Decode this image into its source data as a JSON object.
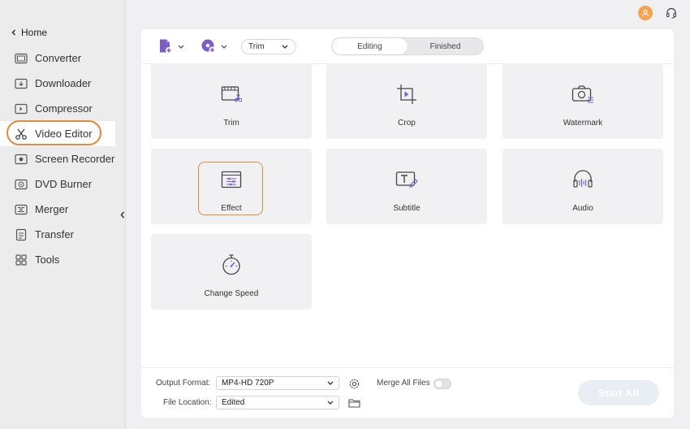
{
  "window": {
    "controls": [
      "close",
      "minimize"
    ]
  },
  "topbar": {
    "user_icon": "user-avatar-icon",
    "help_icon": "headset-icon",
    "accent": "#f6a351"
  },
  "sidebar": {
    "home_label": "Home",
    "items": [
      {
        "label": "Converter",
        "icon": "converter-icon"
      },
      {
        "label": "Downloader",
        "icon": "downloader-icon"
      },
      {
        "label": "Compressor",
        "icon": "compressor-icon"
      },
      {
        "label": "Video Editor",
        "icon": "scissors-icon",
        "active": true
      },
      {
        "label": "Screen Recorder",
        "icon": "screen-recorder-icon"
      },
      {
        "label": "DVD Burner",
        "icon": "dvd-icon"
      },
      {
        "label": "Merger",
        "icon": "merger-icon"
      },
      {
        "label": "Transfer",
        "icon": "transfer-icon"
      },
      {
        "label": "Tools",
        "icon": "tools-icon"
      }
    ],
    "highlight_color": "#e38a3b"
  },
  "toolbar": {
    "trim_select": "Trim",
    "tabs": [
      "Editing",
      "Finished"
    ],
    "active_tab": "Editing",
    "brand_color": "#7b5cc9"
  },
  "tools": [
    {
      "label": "Trim",
      "icon": "trim-icon"
    },
    {
      "label": "Crop",
      "icon": "crop-icon"
    },
    {
      "label": "Watermark",
      "icon": "watermark-icon"
    },
    {
      "label": "Effect",
      "icon": "effect-icon",
      "selected": true
    },
    {
      "label": "Subtitle",
      "icon": "subtitle-icon"
    },
    {
      "label": "Audio",
      "icon": "audio-icon"
    },
    {
      "label": "Change Speed",
      "icon": "speed-icon"
    }
  ],
  "footer": {
    "output_format_label": "Output Format:",
    "output_format_value": "MP4-HD 720P",
    "merge_label": "Merge All Files",
    "merge_on": false,
    "file_location_label": "File Location:",
    "file_location_value": "Edited",
    "start_all_label": "Start All"
  }
}
